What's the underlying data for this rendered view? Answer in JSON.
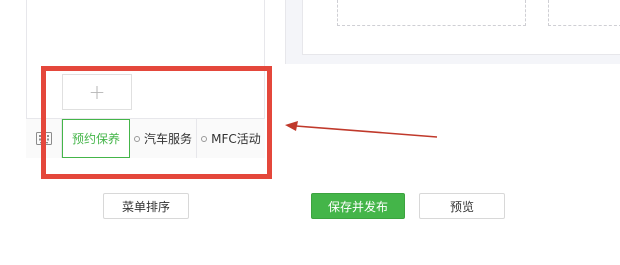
{
  "menu": {
    "add_symbol": "+",
    "items": [
      {
        "label": "预约保养",
        "selected": true
      },
      {
        "label": "汽车服务",
        "selected": false
      },
      {
        "label": "MFC活动",
        "selected": false
      }
    ]
  },
  "buttons": {
    "sort_label": "菜单排序",
    "save_label": "保存并发布",
    "preview_label": "预览"
  },
  "colors": {
    "accent_green": "#44b549",
    "annotation_red": "#e4473b",
    "arrow_red": "#c0392b"
  },
  "icons": {
    "keyboard": "keyboard-icon",
    "add": "plus-icon"
  }
}
